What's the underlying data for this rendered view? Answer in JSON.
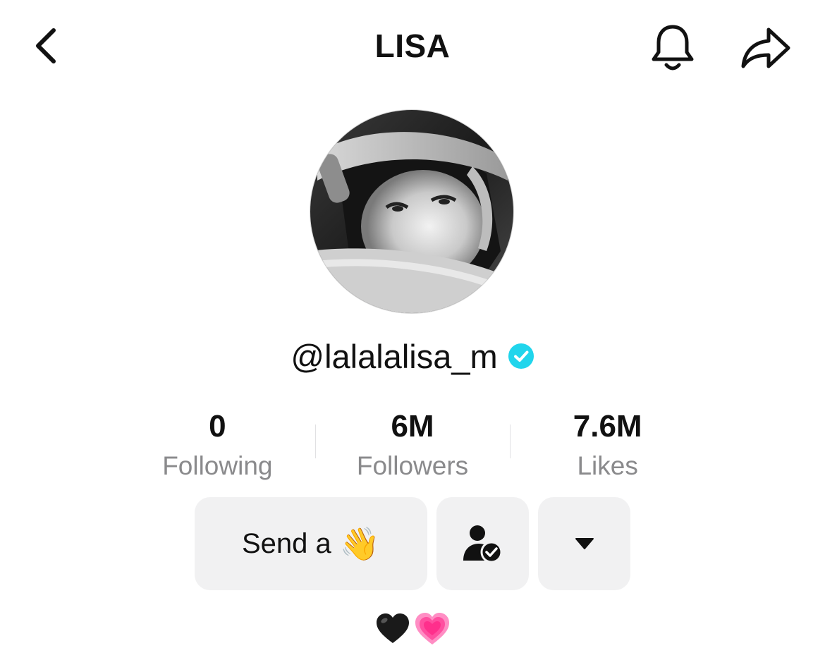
{
  "header": {
    "title": "LISA",
    "back_icon": "chevron-left-icon",
    "bell_icon": "bell-icon",
    "share_icon": "share-arrow-icon"
  },
  "profile": {
    "avatar_description_icon": "profile-photo",
    "username": "@lalalalisa_m",
    "verified": true,
    "verified_color": "#20D5EC"
  },
  "stats": [
    {
      "value": "0",
      "label": "Following"
    },
    {
      "value": "6M",
      "label": "Followers"
    },
    {
      "value": "7.6M",
      "label": "Likes"
    }
  ],
  "actions": {
    "send_label": "Send a",
    "send_emoji": "👋",
    "friend_icon": "person-check-icon",
    "more_icon": "caret-down-icon"
  },
  "bio": {
    "hearts": [
      "black-heart",
      "pink-growing-heart"
    ],
    "colors": {
      "black_heart": "#1a1a1a",
      "pink_heart": "#ff5fa8"
    }
  }
}
